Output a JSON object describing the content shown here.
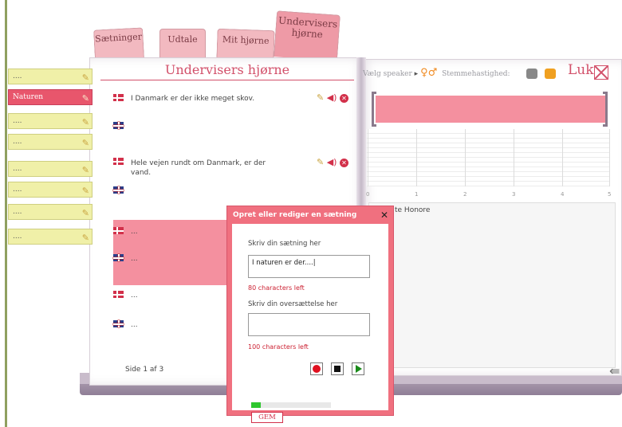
{
  "tabs": [
    {
      "label": "Sætninger"
    },
    {
      "label": "Udtale"
    },
    {
      "label": "Mit hjørne"
    },
    {
      "label_line1": "Undervisers",
      "label_line2": "hjørne"
    }
  ],
  "sidebar": {
    "items": [
      {
        "label": "...."
      },
      {
        "label": "Naturen",
        "selected": true
      },
      {
        "label": "...."
      },
      {
        "label": "...."
      },
      {
        "label": "...."
      },
      {
        "label": "...."
      },
      {
        "label": "...."
      },
      {
        "label": "...."
      }
    ]
  },
  "left_page": {
    "title": "Undervisers hjørne",
    "sentences": [
      {
        "danish": "I Danmark er der ikke meget skov.",
        "english": ""
      },
      {
        "danish": "Hele vejen rundt om Danmark, er der vand.",
        "english": ""
      },
      {
        "danish": "...",
        "english": "..."
      },
      {
        "danish": "...",
        "english": "..."
      }
    ],
    "page_info": "Side 1 af 3"
  },
  "right_page": {
    "choose_speaker": "Vælg speaker",
    "voice_speed": "Stemmehastighed:",
    "close_label": "Luk",
    "axis_ticks": [
      "0",
      "1",
      "2",
      "3",
      "4",
      "5"
    ],
    "info_text": "te Honore"
  },
  "dialog": {
    "title": "Opret eller rediger en sætning",
    "close_symbol": "✕",
    "sentence_label": "Skriv din sætning her",
    "sentence_value": "I naturen er der....|",
    "sentence_chars_left": "80 characters left",
    "translation_label": "Skriv din oversættelse her",
    "translation_value": "",
    "translation_chars_left": "100 characters left",
    "recording_progress": 0.12,
    "save_label": "GEM"
  },
  "colors": {
    "accent": "#d2506a",
    "selected_item": "#e8566c",
    "side_item": "#f0f0a8",
    "highlight": "#f4909f",
    "dialog_frame": "#f0707f"
  }
}
